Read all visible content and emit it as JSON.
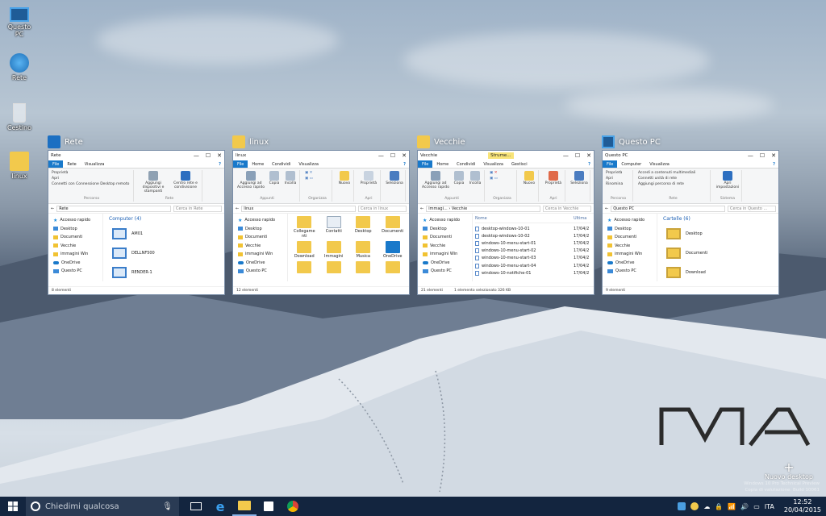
{
  "desktop_icons": [
    {
      "label": "Questo PC",
      "icon": "pc-icon"
    },
    {
      "label": "Rete",
      "icon": "network-icon"
    },
    {
      "label": "Cestino",
      "icon": "recycle-bin-icon"
    },
    {
      "label": "linux",
      "icon": "user-folder-icon"
    }
  ],
  "windows": [
    {
      "title": "Rete",
      "window_title": "Rete",
      "tabs": [
        "File",
        "Rete",
        "Visualizza"
      ],
      "ribbon": {
        "groups": [
          {
            "items": [
              "Proprietà",
              "Apri",
              "Connetti con Connessione Desktop remoto"
            ],
            "label": "Percorso"
          },
          {
            "items": [
              "Aggiungi dispositivi e stampanti",
              "Centro rete e condivisione"
            ],
            "label": "Rete"
          }
        ]
      },
      "address": "Rete",
      "search_placeholder": "Cerca in Rete",
      "section_header": "Computer (4)",
      "items": [
        "AM01",
        "DELLNF500",
        "RENDER-1"
      ],
      "status": [
        "8 elementi"
      ]
    },
    {
      "title": "linux",
      "window_title": "linux",
      "tabs": [
        "File",
        "Home",
        "Condividi",
        "Visualizza"
      ],
      "ribbon": {
        "groups": [
          {
            "items": [
              "Aggiungi ad Accesso rapido",
              "Copia",
              "Incolla"
            ],
            "label": "Appunti"
          },
          {
            "items": [
              ""
            ],
            "label": "Organizza"
          },
          {
            "items": [
              "Nuovo"
            ],
            "label": ""
          },
          {
            "items": [
              "Proprietà"
            ],
            "label": "Apri"
          },
          {
            "items": [
              "Seleziona"
            ],
            "label": ""
          }
        ]
      },
      "address": "linux",
      "search_placeholder": "Cerca in linux",
      "items": [
        "Collegame nti",
        "Contatti",
        "Desktop",
        "Documenti",
        "Download",
        "Immagini",
        "Musica",
        "OneDrive",
        "",
        "",
        "",
        ""
      ],
      "status": [
        "12 elementi"
      ]
    },
    {
      "title": "Vecchie",
      "window_title": "Vecchie",
      "context_tab": "Strume...",
      "tabs": [
        "File",
        "Home",
        "Condividi",
        "Visualizza",
        "Gestisci"
      ],
      "ribbon": {
        "groups": [
          {
            "items": [
              "Aggiungi ad Accesso rapido",
              "Copia",
              "Incolla"
            ],
            "label": "Appunti"
          },
          {
            "items": [
              ""
            ],
            "label": "Organizza"
          },
          {
            "items": [
              "Nuovo"
            ],
            "label": ""
          },
          {
            "items": [
              "Proprietà"
            ],
            "label": "Apri"
          },
          {
            "items": [
              "Seleziona"
            ],
            "label": ""
          }
        ]
      },
      "address": "immagi... › Vecchie",
      "search_placeholder": "Cerca in Vecchie",
      "col_name": "Nome",
      "col_date": "Ultima",
      "items": [
        "desktop-windows-10-01",
        "desktop-windows-10-02",
        "windows-10-menu-start-01",
        "windows-10-menu-start-02",
        "windows-10-menu-start-03",
        "windows-10-menu-start-04",
        "windows-10-notifiche-01"
      ],
      "dates": [
        "17/04/2",
        "17/04/2",
        "17/04/2",
        "17/04/2",
        "17/04/2",
        "17/04/2",
        "17/04/2"
      ],
      "status": [
        "21 elementi",
        "1 elemento selezionato 326 KB"
      ]
    },
    {
      "title": "Questo PC",
      "window_title": "Questo PC",
      "tabs": [
        "File",
        "Computer",
        "Visualizza"
      ],
      "ribbon": {
        "groups": [
          {
            "items": [
              "Proprietà",
              "Apri",
              "Rinomina"
            ],
            "label": "Percorso"
          },
          {
            "items": [
              "Accedi a contenuti multimediali",
              "Connetti unità di rete",
              "Aggiungi percorso di rete"
            ],
            "label": "Rete"
          },
          {
            "items": [
              "Apri impostazioni"
            ],
            "label": "Sistema"
          }
        ]
      },
      "address": "Questo PC",
      "search_placeholder": "Cerca in Questo ...",
      "section_header": "Cartelle (6)",
      "items": [
        "Desktop",
        "Documenti",
        "Download"
      ],
      "status": [
        "9 elementi"
      ]
    }
  ],
  "nav_pane": [
    "Accesso rapido",
    "Desktop",
    "Documenti",
    "Vecchie",
    "immagini Win",
    "OneDrive",
    "Questo PC"
  ],
  "new_desktop": "Nuovo desktop",
  "watermark": [
    "Windows 10 Pro Technical Preview",
    "Copia di valutazione. Build 10061"
  ],
  "taskbar": {
    "search_placeholder": "Chiedimi qualcosa",
    "language": "ITA",
    "time": "12:52",
    "date": "20/04/2015"
  }
}
